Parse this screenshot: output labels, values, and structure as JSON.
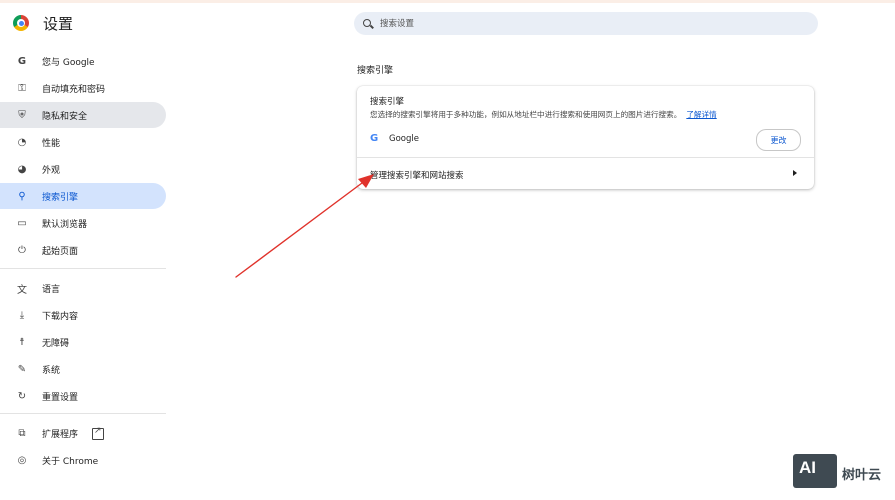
{
  "header": {
    "title": "设置",
    "search_placeholder": "搜索设置"
  },
  "sidebar": {
    "items": [
      {
        "label": "您与 Google",
        "icon": "google-g-icon"
      },
      {
        "label": "自动填充和密码",
        "icon": "key-icon"
      },
      {
        "label": "隐私和安全",
        "icon": "shield-icon"
      },
      {
        "label": "性能",
        "icon": "speedometer-icon"
      },
      {
        "label": "外观",
        "icon": "palette-icon"
      },
      {
        "label": "搜索引擎",
        "icon": "search-icon"
      },
      {
        "label": "默认浏览器",
        "icon": "browser-window-icon"
      },
      {
        "label": "起始页面",
        "icon": "power-icon"
      },
      {
        "label": "语言",
        "icon": "translate-icon"
      },
      {
        "label": "下载内容",
        "icon": "download-icon"
      },
      {
        "label": "无障碍",
        "icon": "accessibility-icon"
      },
      {
        "label": "系统",
        "icon": "wrench-icon"
      },
      {
        "label": "重置设置",
        "icon": "reset-icon"
      },
      {
        "label": "扩展程序",
        "icon": "puzzle-icon"
      },
      {
        "label": "关于 Chrome",
        "icon": "chrome-icon"
      }
    ],
    "active_label": "搜索引擎",
    "hover_label": "隐私和安全"
  },
  "main": {
    "section_title": "搜索引擎",
    "card": {
      "heading": "搜索引擎",
      "description": "您选择的搜索引擎将用于多种功能，例如从地址栏中进行搜索和使用网页上的图片进行搜索。",
      "learn_more": "了解详情",
      "engine_name": "Google",
      "change_button": "更改",
      "manage_label": "管理搜索引擎和网站搜索"
    }
  },
  "watermark": {
    "logo_text": "AI",
    "name": "树叶云"
  },
  "colors": {
    "active_bg": "#d3e3fd",
    "active_text": "#0b57d0",
    "hover_bg": "#e5e7eb",
    "search_bg": "#e9eef6",
    "annotation_arrow": "#e0322b"
  }
}
